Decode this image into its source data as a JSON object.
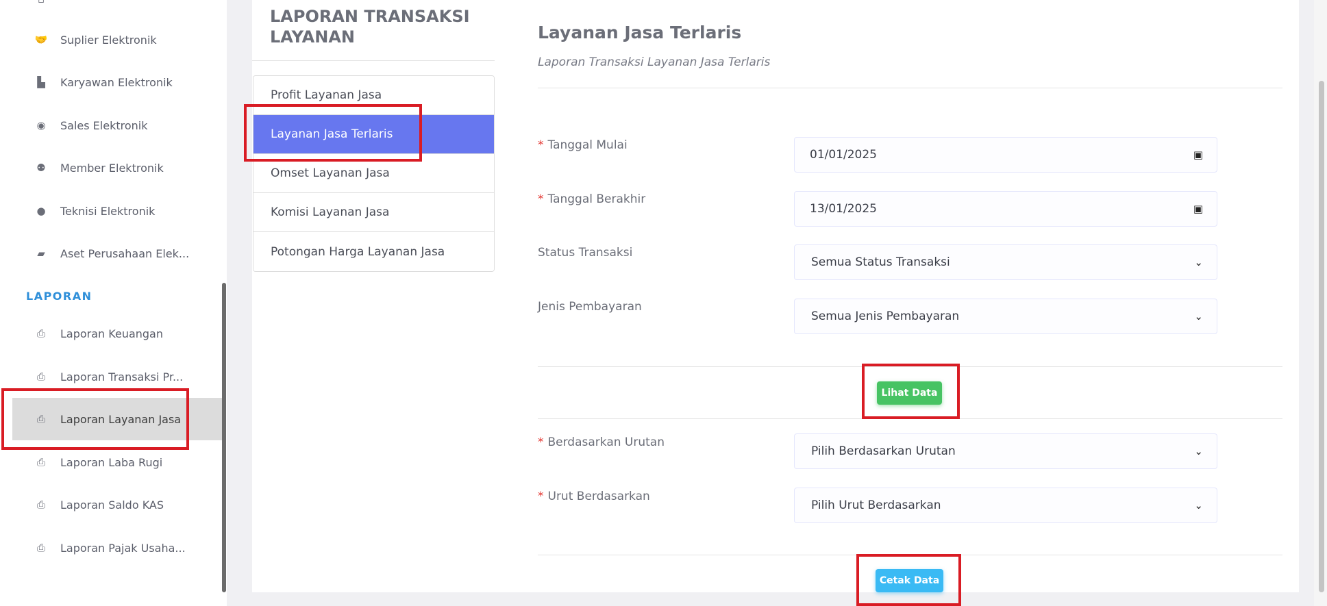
{
  "sidebar": {
    "items_top": [
      {
        "label": "Suplier Elektronik",
        "icon": "handshake-icon",
        "glyph": "🤝"
      },
      {
        "label": "Karyawan Elektronik",
        "icon": "id-badge-icon",
        "glyph": "▙"
      },
      {
        "label": "Sales Elektronik",
        "icon": "user-circle-icon",
        "glyph": "◉"
      },
      {
        "label": "Member Elektronik",
        "icon": "users-icon",
        "glyph": "⚉"
      },
      {
        "label": "Teknisi Elektronik",
        "icon": "user-icon",
        "glyph": "●"
      },
      {
        "label": "Aset Perusahaan Elek...",
        "icon": "book-icon",
        "glyph": "▰"
      }
    ],
    "section_title": "LAPORAN",
    "items_laporan": [
      {
        "label": "Laporan Keuangan",
        "icon": "print-icon",
        "glyph": "⎙"
      },
      {
        "label": "Laporan Transaksi Pr...",
        "icon": "print-icon",
        "glyph": "⎙"
      },
      {
        "label": "Laporan Layanan Jasa",
        "icon": "print-icon",
        "glyph": "⎙"
      },
      {
        "label": "Laporan Laba Rugi",
        "icon": "print-icon",
        "glyph": "⎙"
      },
      {
        "label": "Laporan Saldo KAS",
        "icon": "print-icon",
        "glyph": "⎙"
      },
      {
        "label": "Laporan Pajak Usaha...",
        "icon": "print-icon",
        "glyph": "⎙"
      }
    ],
    "active_label": "Laporan Layanan Jasa"
  },
  "left_panel": {
    "title": "LAPORAN TRANSAKSI LAYANAN",
    "menu": [
      "Profit Layanan Jasa",
      "Layanan Jasa Terlaris",
      "Omset Layanan Jasa",
      "Komisi Layanan Jasa",
      "Potongan Harga Layanan Jasa"
    ],
    "active": "Layanan Jasa Terlaris"
  },
  "form": {
    "title": "Layanan Jasa Terlaris",
    "subtitle": "Laporan Transaksi Layanan Jasa Terlaris",
    "required_mark": "*",
    "tanggal_mulai_label": "Tanggal Mulai",
    "tanggal_mulai_value": "01/01/2025",
    "tanggal_berakhir_label": "Tanggal Berakhir",
    "tanggal_berakhir_value": "13/01/2025",
    "status_label": "Status Transaksi",
    "status_value": "Semua Status Transaksi",
    "jenis_label": "Jenis Pembayaran",
    "jenis_value": "Semua Jenis Pembayaran",
    "lihat_button": "Lihat Data",
    "urutan_label": "Berdasarkan Urutan",
    "urutan_value": "Pilih Berdasarkan Urutan",
    "urut_label": "Urut Berdasarkan",
    "urut_value": "Pilih Urut Berdasarkan",
    "cetak_button": "Cetak Data",
    "calendar_glyph": "▣",
    "chevron_glyph": "⌄"
  },
  "colors": {
    "accent": "#6777ef",
    "green": "#47c363",
    "blue": "#3abaf4",
    "highlight": "#d91c24",
    "section": "#2f8fd9"
  }
}
